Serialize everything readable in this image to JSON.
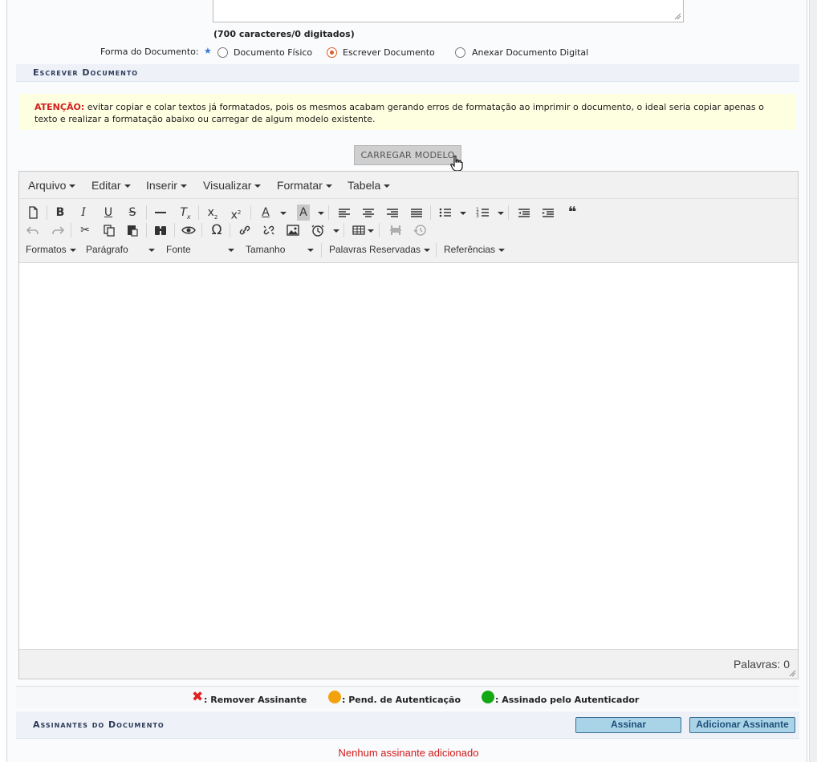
{
  "form": {
    "char_count": "(700 caracteres/0 digitados)",
    "forma_label": "Forma do Documento:",
    "required_mark": "★",
    "radio_options": [
      "Documento Físico",
      "Escrever Documento",
      "Anexar Documento Digital"
    ],
    "selected_option": "Escrever Documento"
  },
  "escrever_section": {
    "title": "Escrever Documento",
    "warning_label": "ATENÇÃO:",
    "warning_text": " evitar copiar e colar textos já formatados, pois os mesmos acabam gerando erros de formatação ao imprimir o documento, o ideal seria copiar apenas o texto e realizar a formatação abaixo ou carregar de algum modelo existente.",
    "load_model_button": "CARREGAR MODELO"
  },
  "editor": {
    "menus": [
      "Arquivo",
      "Editar",
      "Inserir",
      "Visualizar",
      "Formatar",
      "Tabela"
    ],
    "dropdowns": {
      "formatos": "Formatos",
      "paragrafo": "Parágrafo",
      "fonte": "Fonte",
      "tamanho": "Tamanho",
      "palavras_reservadas": "Palavras Reservadas",
      "referencias": "Referências"
    },
    "word_count": "Palavras: 0"
  },
  "legend": {
    "remove": ": Remover Assinante",
    "pending": ": Pend. de Autenticação",
    "signed": ": Assinado pelo Autenticador",
    "colors": {
      "remove": "#e02020",
      "pending": "#f2a20c",
      "signed": "#14a814"
    }
  },
  "assinantes": {
    "title": "Assinantes do Documento",
    "sign_button": "Assinar",
    "add_button": "Adicionar Assinante",
    "empty_message": "Nenhum assinante adicionado"
  }
}
